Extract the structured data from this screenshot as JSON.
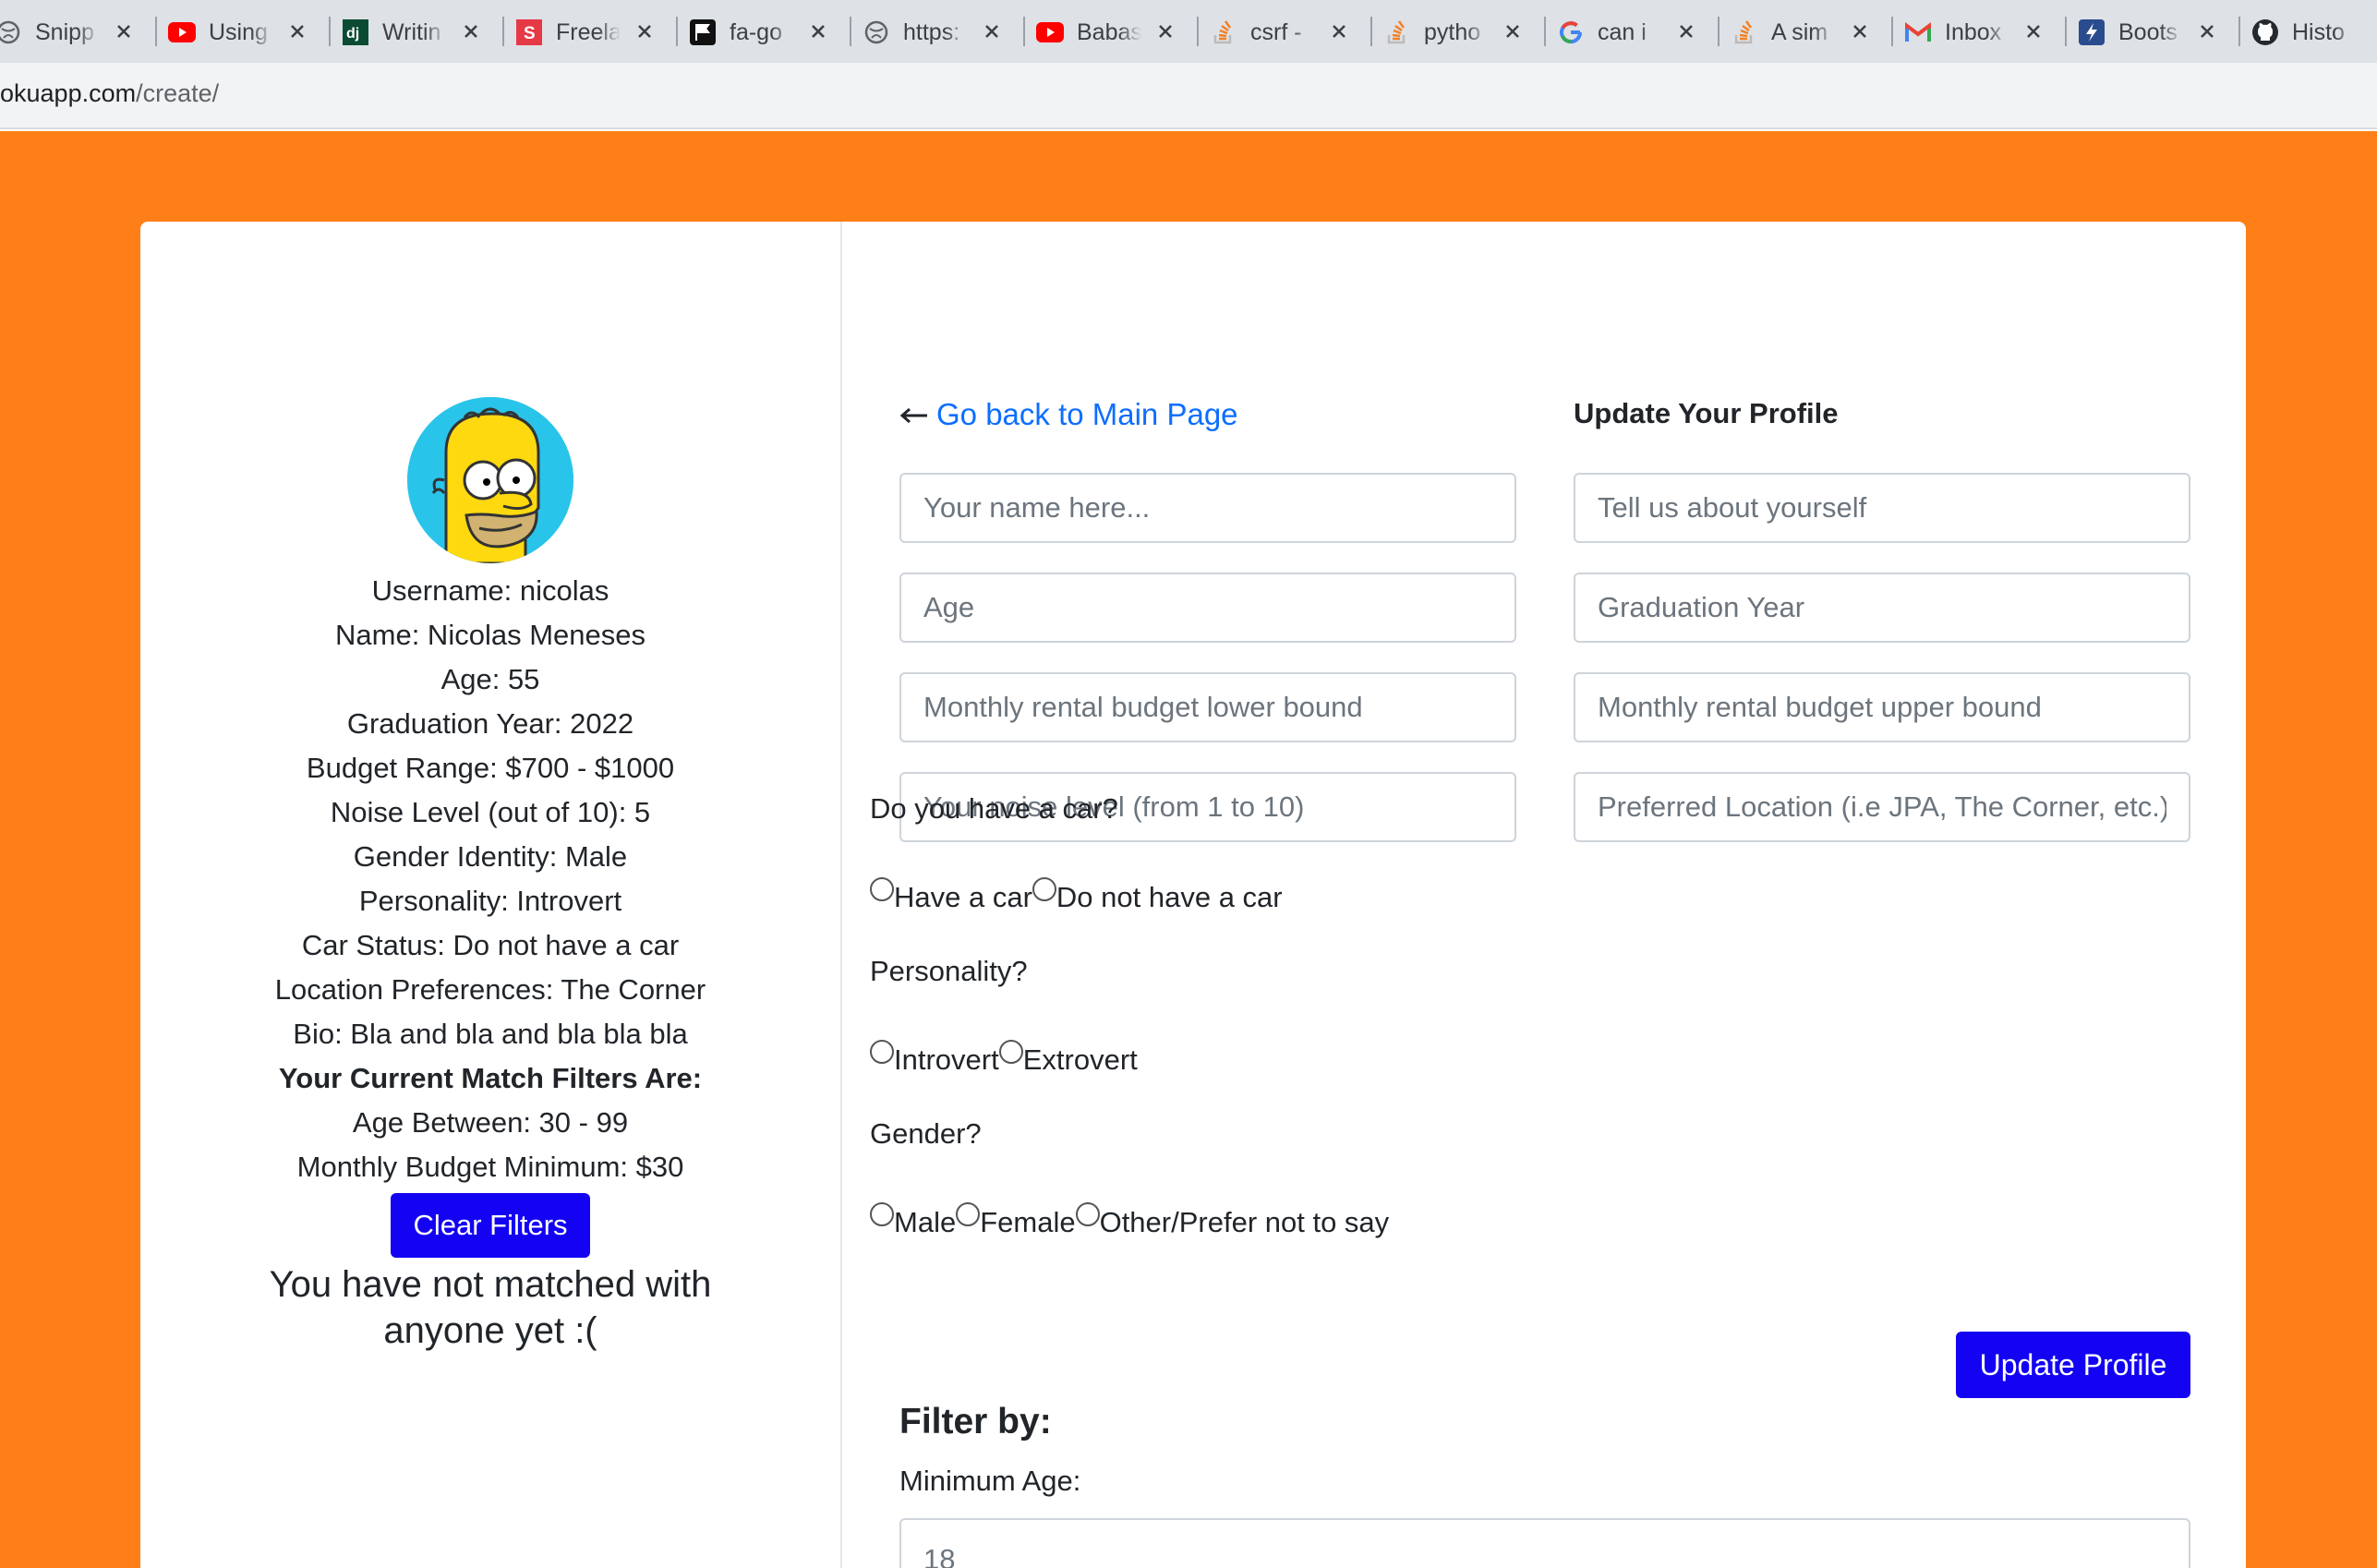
{
  "browser": {
    "tabs": [
      {
        "title": "Snipp",
        "icon": "globe-icon"
      },
      {
        "title": "Using",
        "icon": "youtube-icon"
      },
      {
        "title": "Writin",
        "icon": "django-icon"
      },
      {
        "title": "Freela",
        "icon": "s-brand-icon"
      },
      {
        "title": "fa-go",
        "icon": "flag-icon"
      },
      {
        "title": "https:",
        "icon": "globe-icon"
      },
      {
        "title": "Babas",
        "icon": "youtube-icon"
      },
      {
        "title": "csrf -",
        "icon": "stackoverflow-icon"
      },
      {
        "title": "pytho",
        "icon": "stackoverflow-icon"
      },
      {
        "title": "can i",
        "icon": "google-icon"
      },
      {
        "title": "A sim",
        "icon": "stackoverflow-icon"
      },
      {
        "title": "Inbox",
        "icon": "gmail-icon"
      },
      {
        "title": "Boots",
        "icon": "bootstrap-icon"
      },
      {
        "title": "Histo",
        "icon": "github-icon"
      }
    ],
    "url_host": "okuapp.com",
    "url_path": "/create/"
  },
  "colors": {
    "page_bg": "#fe7f17",
    "primary_button": "#1303f2",
    "link": "#0d6efd",
    "avatar_bg": "#29c4e9"
  },
  "profile": {
    "avatar_icon": "homer-simpson-avatar",
    "lines": [
      "Username: nicolas",
      "Name: Nicolas Meneses",
      "Age: 55",
      "Graduation Year: 2022",
      "Budget Range: $700 - $1000",
      "Noise Level (out of 10): 5",
      "Gender Identity: Male",
      "Personality: Introvert",
      "Car Status: Do not have a car",
      "Location Preferences: The Corner",
      "Bio: Bla and bla and bla bla bla"
    ],
    "filters_heading": "Your Current Match Filters Are:",
    "filter_lines": [
      "Age Between: 30 - 99",
      "Monthly Budget Minimum: $30"
    ],
    "clear_button": "Clear Filters",
    "no_match_line1": "You have not matched with",
    "no_match_line2": "anyone yet :("
  },
  "form": {
    "back_link": "Go back to Main Page",
    "title": "Update Your Profile",
    "fields": {
      "name": "Your name here...",
      "bio": "Tell us about yourself",
      "age": "Age",
      "grad_year": "Graduation Year",
      "budget_low": "Monthly rental budget lower bound",
      "budget_high": "Monthly rental budget upper bound",
      "noise": "Your noise level (from 1 to 10)",
      "location": "Preferred Location (i.e JPA, The Corner, etc.)"
    },
    "car_question": "Do you have a car?",
    "car_options": [
      "Have a car",
      "Do not have a car"
    ],
    "personality_question": "Personality?",
    "personality_options": [
      "Introvert",
      "Extrovert"
    ],
    "gender_question": "Gender?",
    "gender_options": [
      "Male",
      "Female",
      "Other/Prefer not to say"
    ],
    "submit": "Update Profile"
  },
  "filter": {
    "title": "Filter by:",
    "min_age_label": "Minimum Age:",
    "min_age_value": "18"
  }
}
